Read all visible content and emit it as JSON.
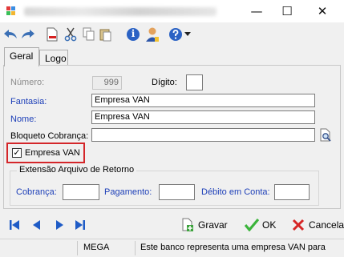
{
  "titlebar": {
    "minimize": "—",
    "maximize": "☐",
    "close": "✕"
  },
  "toolbar": {
    "info_label": "i"
  },
  "tabs": [
    {
      "label": "Geral"
    },
    {
      "label": "Logo"
    }
  ],
  "form": {
    "numero_label": "Número:",
    "numero_value": "999",
    "digito_label": "Dígito:",
    "digito_value": "",
    "fantasia_label": "Fantasia:",
    "fantasia_value": "Empresa VAN",
    "nome_label": "Nome:",
    "nome_value": "Empresa VAN",
    "bloqueto_label": "Bloqueto Cobrança:",
    "bloqueto_value": "",
    "empresa_van_label": "Empresa VAN",
    "empresa_van_checked": "✓"
  },
  "extensao": {
    "title": "Extensão Arquivo de Retorno",
    "cobranca_label": "Cobrança:",
    "cobranca_value": "",
    "pagamento_label": "Pagamento:",
    "pagamento_value": "",
    "debito_label": "Débito em Conta:",
    "debito_value": ""
  },
  "actions": {
    "gravar": "Gravar",
    "ok": "OK",
    "cancela": "Cancela"
  },
  "statusbar": {
    "user": "MEGA",
    "message": "Este banco representa uma empresa VAN para"
  },
  "colors": {
    "accent": "#1d3fb8",
    "highlight": "#d4262a",
    "nav_blue": "#1e5bc6"
  }
}
